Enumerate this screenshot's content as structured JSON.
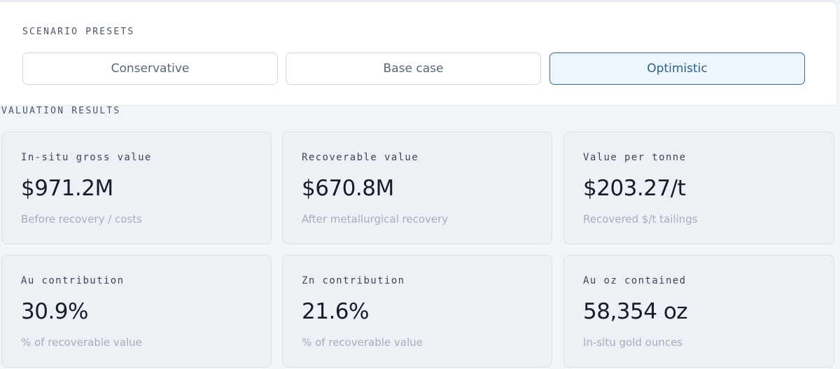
{
  "presets": {
    "title": "SCENARIO PRESETS",
    "options": [
      {
        "label": "Conservative",
        "active": false
      },
      {
        "label": "Base case",
        "active": false
      },
      {
        "label": "Optimistic",
        "active": true
      }
    ]
  },
  "results": {
    "title": "VALUATION RESULTS",
    "cards": [
      {
        "label": "In-situ gross value",
        "value": "$971.2M",
        "sub": "Before recovery / costs"
      },
      {
        "label": "Recoverable value",
        "value": "$670.8M",
        "sub": "After metallurgical recovery"
      },
      {
        "label": "Value per tonne",
        "value": "$203.27/t",
        "sub": "Recovered $/t tailings"
      },
      {
        "label": "Au contribution",
        "value": "30.9%",
        "sub": "% of recoverable value"
      },
      {
        "label": "Zn contribution",
        "value": "21.6%",
        "sub": "% of recoverable value"
      },
      {
        "label": "Au oz contained",
        "value": "58,354 oz",
        "sub": "In-situ gold ounces"
      }
    ]
  },
  "colors": {
    "accent": "#3b6a93",
    "active_bg": "#edf5fd",
    "card_bg": "#edf1f6"
  }
}
